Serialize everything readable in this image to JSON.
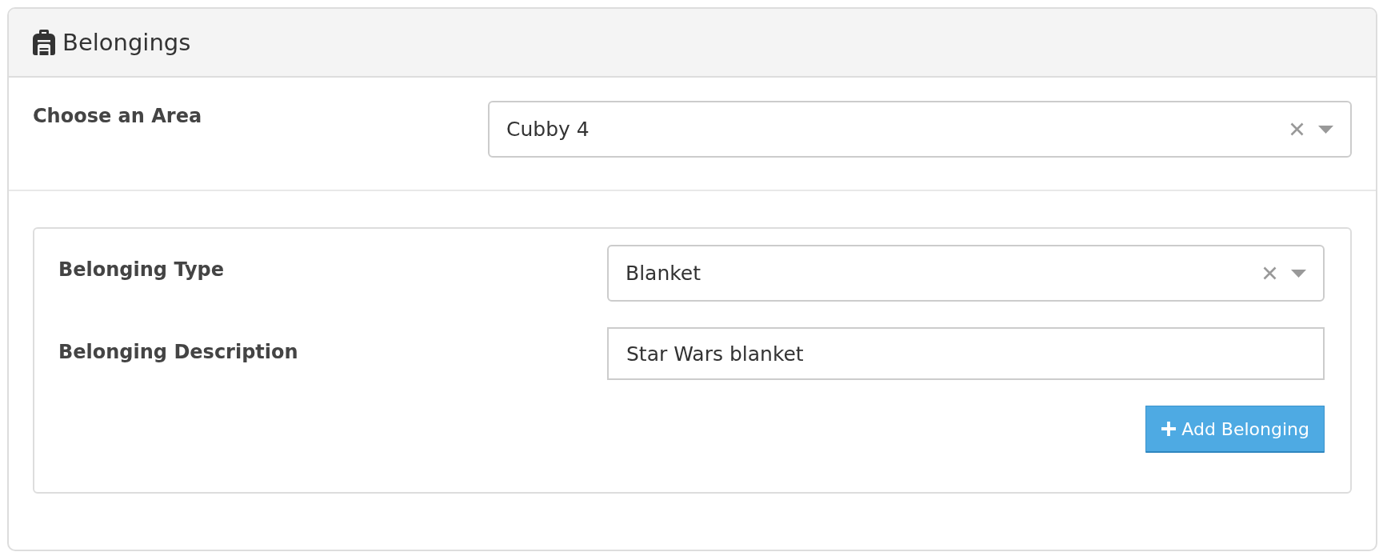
{
  "panel": {
    "title": "Belongings"
  },
  "area": {
    "label": "Choose an Area",
    "value": "Cubby 4"
  },
  "belonging_form": {
    "fields": [
      {
        "kind": "select",
        "label": "Belonging Type",
        "value": "Blanket"
      },
      {
        "kind": "text",
        "label": "Belonging Description",
        "value": "Star Wars blanket"
      }
    ],
    "button": {
      "label": "Add Belonging"
    }
  }
}
